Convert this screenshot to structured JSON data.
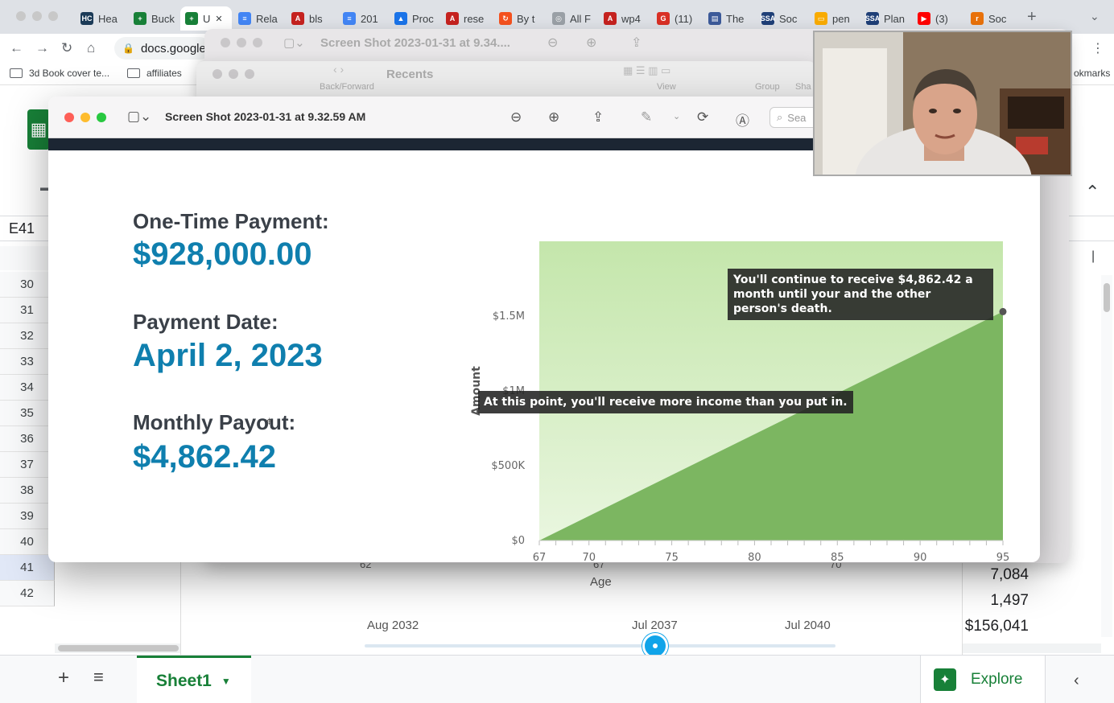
{
  "browser": {
    "tabs": [
      {
        "label": "Hea",
        "favicon_color": "#1b3a57",
        "favicon_text": "HC"
      },
      {
        "label": "Buck",
        "favicon_color": "#188038",
        "favicon_text": "+"
      },
      {
        "label": "U",
        "favicon_color": "#188038",
        "favicon_text": "+",
        "active": true
      },
      {
        "label": "Rela",
        "favicon_color": "#4285f4",
        "favicon_text": "≡"
      },
      {
        "label": "bls",
        "favicon_color": "#c5221f",
        "favicon_text": "A"
      },
      {
        "label": "201",
        "favicon_color": "#4285f4",
        "favicon_text": "≡"
      },
      {
        "label": "Proc",
        "favicon_color": "#1a73e8",
        "favicon_text": "▲"
      },
      {
        "label": "rese",
        "favicon_color": "#c5221f",
        "favicon_text": "A"
      },
      {
        "label": "By t",
        "favicon_color": "#f4511e",
        "favicon_text": "↻"
      },
      {
        "label": "All F",
        "favicon_color": "#9aa0a6",
        "favicon_text": "◎"
      },
      {
        "label": "wp4",
        "favicon_color": "#c5221f",
        "favicon_text": "A"
      },
      {
        "label": "(11)",
        "favicon_color": "#d93025",
        "favicon_text": "G"
      },
      {
        "label": "The",
        "favicon_color": "#3c5a99",
        "favicon_text": "▤"
      },
      {
        "label": "Soc",
        "favicon_color": "#1f3f77",
        "favicon_text": "SSA"
      },
      {
        "label": "pen",
        "favicon_color": "#f9ab00",
        "favicon_text": "▭"
      },
      {
        "label": "Plan",
        "favicon_color": "#1f3f77",
        "favicon_text": "SSA"
      },
      {
        "label": "(3)",
        "favicon_color": "#ff0000",
        "favicon_text": "▶"
      },
      {
        "label": "Soc",
        "favicon_color": "#e8710a",
        "favicon_text": "r"
      }
    ],
    "url": "docs.google",
    "bookmarks": [
      {
        "label": "3d Book cover te..."
      },
      {
        "label": "affiliates"
      }
    ],
    "bookmarks_right": "okmarks"
  },
  "sheets": {
    "cell_ref": "E41",
    "rows": [
      "30",
      "31",
      "32",
      "33",
      "34",
      "35",
      "36",
      "37",
      "38",
      "39",
      "40",
      "41",
      "42"
    ],
    "sheet_tab": "Sheet1",
    "explore_label": "Explore",
    "cell_values": [
      "7,084",
      "1,497",
      "$156,041"
    ]
  },
  "back_window": {
    "title": "Screen Shot 2023-01-31 at 9.34....",
    "finder_title": "Recents",
    "finder_back_label": "Back/Forward",
    "finder_view_label": "View",
    "finder_group_label": "Group",
    "finder_share_label": "Sha"
  },
  "preview": {
    "title": "Screen Shot 2023-01-31 at 9.32.59 AM",
    "search_placeholder": "Sea",
    "one_time_label": "One-Time Payment:",
    "one_time_value": "$928,000.00",
    "payment_date_label": "Payment Date:",
    "payment_date_value": "April 2, 2023",
    "monthly_label": "Monthly Payout:",
    "monthly_value": "$4,862.42"
  },
  "chart_data": {
    "type": "area",
    "x": [
      67,
      95
    ],
    "series": [
      {
        "values": [
          0,
          1530000
        ]
      }
    ],
    "xlabel": "Age",
    "ylabel": "Amount",
    "xticks": [
      "67",
      "70",
      "75",
      "80",
      "85",
      "90",
      "95"
    ],
    "yticks": [
      "$0",
      "$500K",
      "$1M",
      "$1.5M"
    ],
    "xlim": [
      67,
      95
    ],
    "ylim": [
      0,
      2000000
    ],
    "annotations": [
      "You'll continue to receive $4,862.42 a month until your and the other person's death.",
      "At this point, you'll receive more income than you put in."
    ],
    "colors": {
      "area": "#7cb661",
      "background": "#c9e8b4"
    }
  },
  "slider": {
    "labels": [
      "Aug 2032",
      "Jul 2037",
      "Jul 2040"
    ],
    "behind_ticks": [
      "62",
      "67",
      "70"
    ],
    "behind_age_label": "Age",
    "accent": "#10a4e9"
  }
}
